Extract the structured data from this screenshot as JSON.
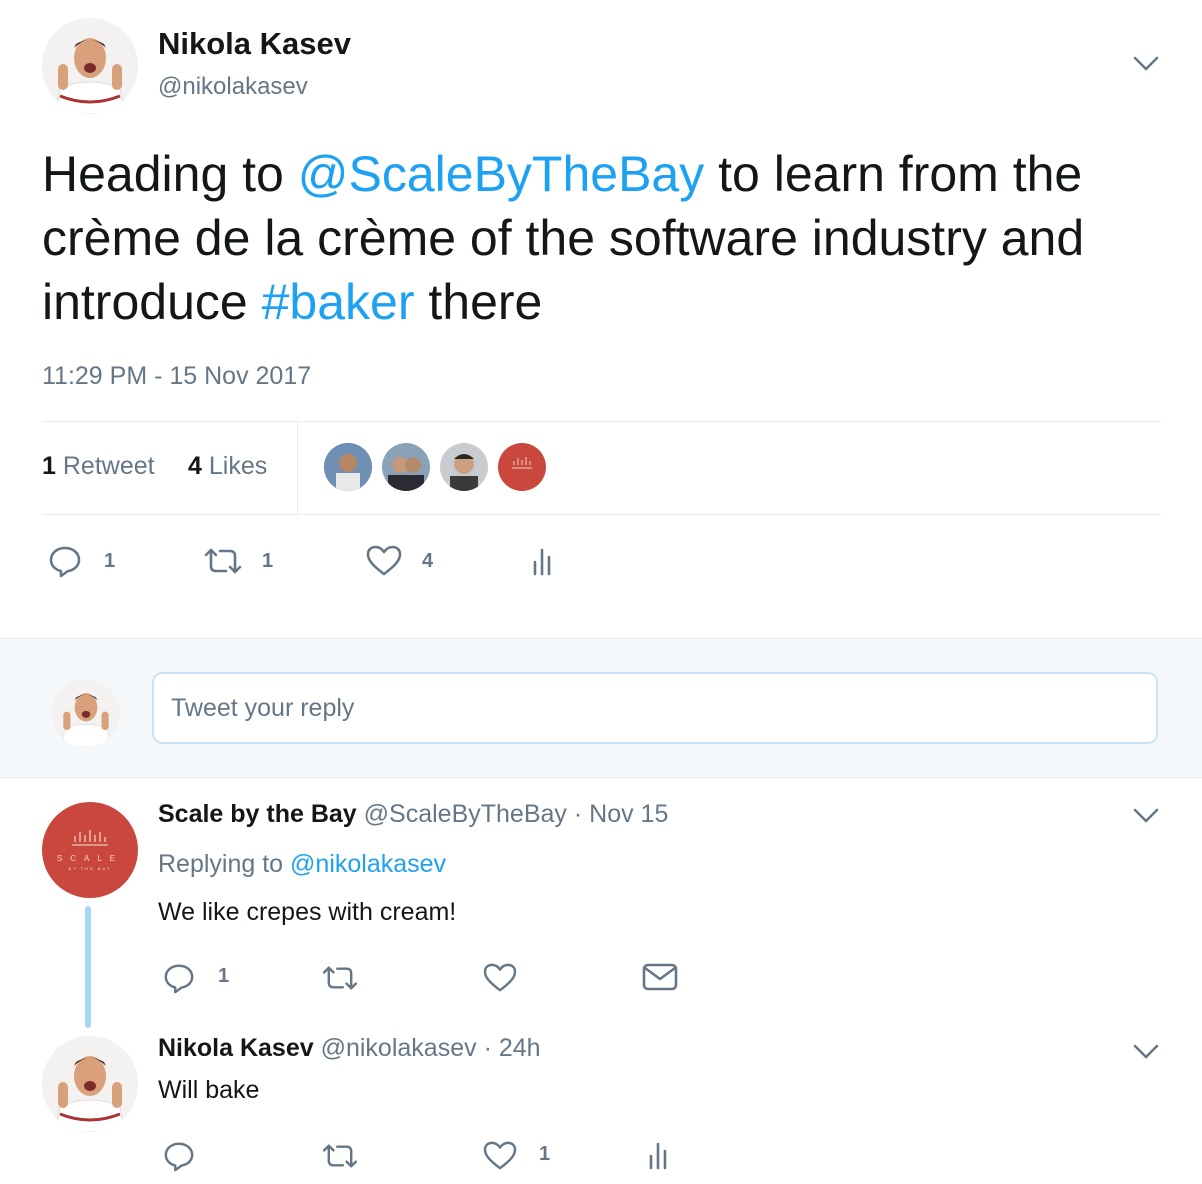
{
  "colors": {
    "link": "#1da1f2",
    "muted": "#657786",
    "brand_red": "#c9473c",
    "bg_reply": "#f5f8fa"
  },
  "tweet": {
    "author_name": "Nikola Kasev",
    "author_handle": "@nikolakasev",
    "text_part1": "Heading to ",
    "mention": "@ScaleByTheBay",
    "text_part2": " to learn from the crème de la crème of the software industry and introduce ",
    "hashtag": "#baker",
    "text_part3": " there",
    "timestamp": "11:29 PM - 15 Nov 2017",
    "retweet_count": "1",
    "retweet_label": "Retweet",
    "likes_count": "4",
    "likes_label": "Likes",
    "actions": {
      "reply_count": "1",
      "retweet_count": "1",
      "like_count": "4"
    }
  },
  "reply_box": {
    "placeholder": "Tweet your reply"
  },
  "replies": [
    {
      "author_name": "Scale by the Bay",
      "author_handle": "@ScaleByTheBay",
      "time": "· Nov 15",
      "replying_label": "Replying to ",
      "replying_to": "@nikolakasev",
      "text": "We like crepes with cream!",
      "reply_count": "1"
    },
    {
      "author_name": "Nikola Kasev",
      "author_handle": "@nikolakasev",
      "time": "· 24h",
      "text": "Will bake",
      "like_count": "1"
    }
  ],
  "logo_text": {
    "main": "SCALE",
    "sub": "BY THE BAY"
  }
}
